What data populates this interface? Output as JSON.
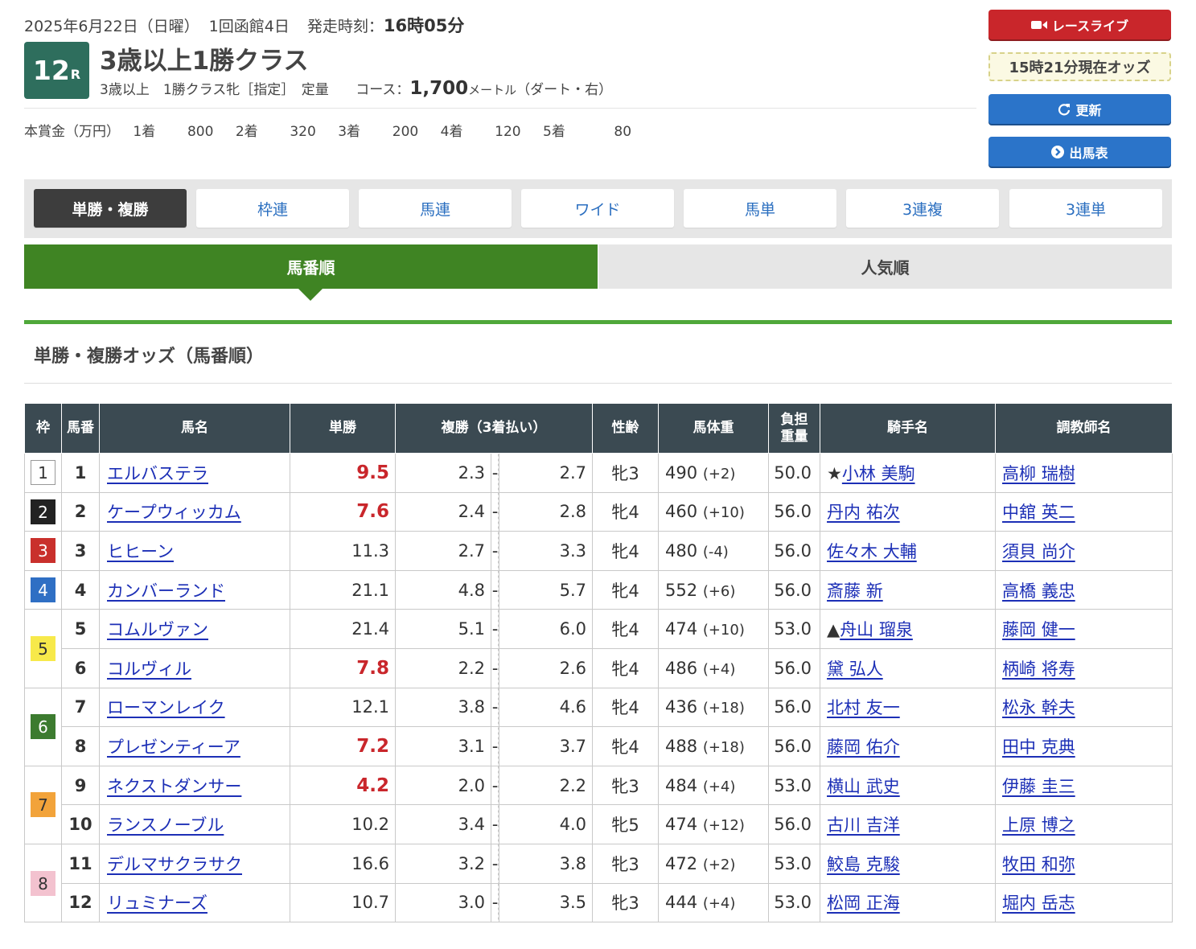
{
  "header": {
    "date": "2025年6月22日（日曜）",
    "meeting": "1回函館4日",
    "post_time_label": "発走時刻：",
    "post_time": "16時05分",
    "race_number": "12",
    "race_suffix": "R",
    "race_title": "3歳以上1勝クラス",
    "race_class": "3歳以上　1勝クラス牝［指定］　定量",
    "course_label": "コース：",
    "course_distance": "1,700",
    "course_unit": "メートル",
    "course_detail": "（ダート・右）",
    "prize_label": "本賞金（万円）",
    "prizes": [
      {
        "place": "1着",
        "amount": "800"
      },
      {
        "place": "2着",
        "amount": "320"
      },
      {
        "place": "3着",
        "amount": "200"
      },
      {
        "place": "4着",
        "amount": "120"
      },
      {
        "place": "5着",
        "amount": "80"
      }
    ]
  },
  "side": {
    "live_label": "レースライブ",
    "odds_time": "15時21分現在オッズ",
    "update_label": "更新",
    "card_label": "出馬表"
  },
  "bet_tabs": [
    "単勝・複勝",
    "枠連",
    "馬連",
    "ワイド",
    "馬単",
    "3連複",
    "3連単"
  ],
  "sort_tabs": {
    "active": "馬番順",
    "inactive": "人気順"
  },
  "section_title": "単勝・複勝オッズ（馬番順）",
  "table": {
    "headers": {
      "waku": "枠",
      "umaban": "馬番",
      "horse": "馬名",
      "win": "単勝",
      "place": "複勝（3着払い）",
      "sex_age": "性齢",
      "body_weight": "馬体重",
      "load_1": "負担",
      "load_2": "重量",
      "jockey": "騎手名",
      "trainer": "調教師名"
    },
    "place_separator": "-",
    "wakus": [
      {
        "num": "1",
        "bg": "#ffffff",
        "fg": "#333333",
        "border": "#999999"
      },
      {
        "num": "2",
        "bg": "#222222",
        "fg": "#ffffff",
        "border": "#222222"
      },
      {
        "num": "3",
        "bg": "#c9302c",
        "fg": "#ffffff",
        "border": "#c9302c"
      },
      {
        "num": "4",
        "bg": "#2f6fc4",
        "fg": "#ffffff",
        "border": "#2f6fc4"
      },
      {
        "num": "5",
        "bg": "#f7e94a",
        "fg": "#333333",
        "border": "#f7e94a"
      },
      {
        "num": "6",
        "bg": "#3c7b2f",
        "fg": "#ffffff",
        "border": "#3c7b2f"
      },
      {
        "num": "7",
        "bg": "#f2a33a",
        "fg": "#333333",
        "border": "#f2a33a"
      },
      {
        "num": "8",
        "bg": "#f3c2cf",
        "fg": "#333333",
        "border": "#f3c2cf"
      }
    ],
    "rows": [
      {
        "umaban": "1",
        "horse": "エルバステラ",
        "win": "9.5",
        "fav": true,
        "pmin": "2.3",
        "pmax": "2.7",
        "sex_age": "牝3",
        "weight": "490",
        "diff": "(+2)",
        "load": "50.0",
        "jockey_mark": "★",
        "jockey": "小林 美駒",
        "trainer": "高柳 瑞樹"
      },
      {
        "umaban": "2",
        "horse": "ケープウィッカム",
        "win": "7.6",
        "fav": true,
        "pmin": "2.4",
        "pmax": "2.8",
        "sex_age": "牝4",
        "weight": "460",
        "diff": "(+10)",
        "load": "56.0",
        "jockey_mark": "",
        "jockey": "丹内 祐次",
        "trainer": "中舘 英二"
      },
      {
        "umaban": "3",
        "horse": "ヒヒーン",
        "win": "11.3",
        "fav": false,
        "pmin": "2.7",
        "pmax": "3.3",
        "sex_age": "牝4",
        "weight": "480",
        "diff": "(-4)",
        "load": "56.0",
        "jockey_mark": "",
        "jockey": "佐々木 大輔",
        "trainer": "須貝 尚介"
      },
      {
        "umaban": "4",
        "horse": "カンバーランド",
        "win": "21.1",
        "fav": false,
        "pmin": "4.8",
        "pmax": "5.7",
        "sex_age": "牝4",
        "weight": "552",
        "diff": "(+6)",
        "load": "56.0",
        "jockey_mark": "",
        "jockey": "斎藤 新",
        "trainer": "高橋 義忠"
      },
      {
        "umaban": "5",
        "horse": "コムルヴァン",
        "win": "21.4",
        "fav": false,
        "pmin": "5.1",
        "pmax": "6.0",
        "sex_age": "牝4",
        "weight": "474",
        "diff": "(+10)",
        "load": "53.0",
        "jockey_mark": "▲",
        "jockey": "舟山 瑠泉",
        "trainer": "藤岡 健一"
      },
      {
        "umaban": "6",
        "horse": "コルヴィル",
        "win": "7.8",
        "fav": true,
        "pmin": "2.2",
        "pmax": "2.6",
        "sex_age": "牝4",
        "weight": "486",
        "diff": "(+4)",
        "load": "56.0",
        "jockey_mark": "",
        "jockey": "黛 弘人",
        "trainer": "柄崎 将寿"
      },
      {
        "umaban": "7",
        "horse": "ローマンレイク",
        "win": "12.1",
        "fav": false,
        "pmin": "3.8",
        "pmax": "4.6",
        "sex_age": "牝4",
        "weight": "436",
        "diff": "(+18)",
        "load": "56.0",
        "jockey_mark": "",
        "jockey": "北村 友一",
        "trainer": "松永 幹夫"
      },
      {
        "umaban": "8",
        "horse": "プレゼンティーア",
        "win": "7.2",
        "fav": true,
        "pmin": "3.1",
        "pmax": "3.7",
        "sex_age": "牝4",
        "weight": "488",
        "diff": "(+18)",
        "load": "56.0",
        "jockey_mark": "",
        "jockey": "藤岡 佑介",
        "trainer": "田中 克典"
      },
      {
        "umaban": "9",
        "horse": "ネクストダンサー",
        "win": "4.2",
        "fav": true,
        "pmin": "2.0",
        "pmax": "2.2",
        "sex_age": "牝3",
        "weight": "484",
        "diff": "(+4)",
        "load": "53.0",
        "jockey_mark": "",
        "jockey": "横山 武史",
        "trainer": "伊藤 圭三"
      },
      {
        "umaban": "10",
        "horse": "ランスノーブル",
        "win": "10.2",
        "fav": false,
        "pmin": "3.4",
        "pmax": "4.0",
        "sex_age": "牝5",
        "weight": "474",
        "diff": "(+12)",
        "load": "56.0",
        "jockey_mark": "",
        "jockey": "古川 吉洋",
        "trainer": "上原 博之"
      },
      {
        "umaban": "11",
        "horse": "デルマサクラサク",
        "win": "16.6",
        "fav": false,
        "pmin": "3.2",
        "pmax": "3.8",
        "sex_age": "牝3",
        "weight": "472",
        "diff": "(+2)",
        "load": "53.0",
        "jockey_mark": "",
        "jockey": "鮫島 克駿",
        "trainer": "牧田 和弥"
      },
      {
        "umaban": "12",
        "horse": "リュミナーズ",
        "win": "10.7",
        "fav": false,
        "pmin": "3.0",
        "pmax": "3.5",
        "sex_age": "牝3",
        "weight": "444",
        "diff": "(+4)",
        "load": "53.0",
        "jockey_mark": "",
        "jockey": "松岡 正海",
        "trainer": "堀内 岳志"
      }
    ]
  }
}
